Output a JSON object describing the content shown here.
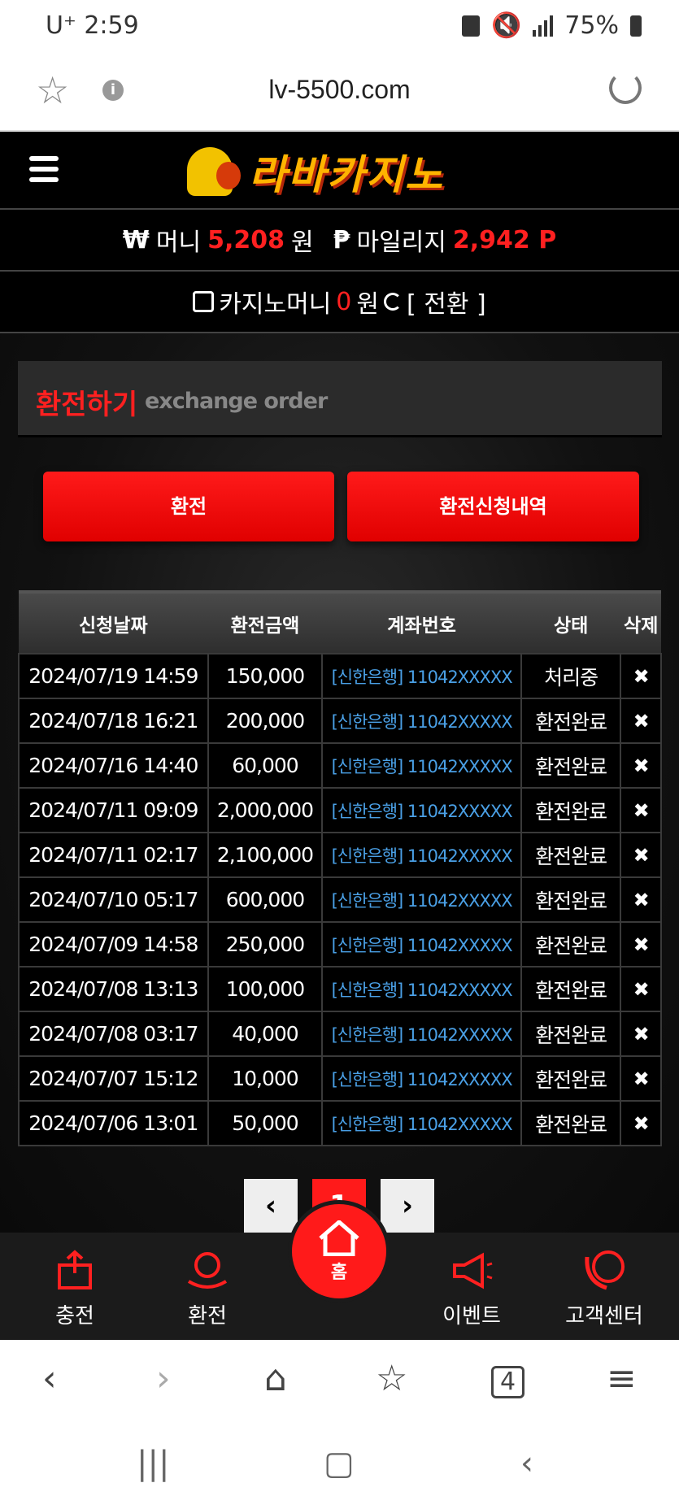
{
  "status_bar": {
    "carrier": "U⁺ 2:59",
    "battery": "75%"
  },
  "browser": {
    "url": "lv-5500.com"
  },
  "header": {
    "logo_text": "라바카지노"
  },
  "balance": {
    "money_symbol": "₩",
    "money_label": "머니",
    "money_value": "5,208",
    "money_unit": "원",
    "mileage_symbol": "₱",
    "mileage_label": "마일리지",
    "mileage_value": "2,942 P"
  },
  "casino": {
    "label": "카지노머니",
    "value": "0",
    "unit": "원",
    "convert_label": "[ 전환 ]"
  },
  "page": {
    "title_ko": "환전하기",
    "title_en": "exchange order"
  },
  "buttons": {
    "exchange": "환전",
    "history": "환전신청내역"
  },
  "table": {
    "headers": [
      "신청날짜",
      "환전금액",
      "계좌번호",
      "상태",
      "삭제"
    ],
    "rows": [
      {
        "date": "2024/07/19 14:59",
        "amount": "150,000",
        "account": "[신한은행] 11042XXXXX",
        "status": "처리중",
        "del": "✖"
      },
      {
        "date": "2024/07/18 16:21",
        "amount": "200,000",
        "account": "[신한은행] 11042XXXXX",
        "status": "환전완료",
        "del": "✖"
      },
      {
        "date": "2024/07/16 14:40",
        "amount": "60,000",
        "account": "[신한은행] 11042XXXXX",
        "status": "환전완료",
        "del": "✖"
      },
      {
        "date": "2024/07/11 09:09",
        "amount": "2,000,000",
        "account": "[신한은행] 11042XXXXX",
        "status": "환전완료",
        "del": "✖"
      },
      {
        "date": "2024/07/11 02:17",
        "amount": "2,100,000",
        "account": "[신한은행] 11042XXXXX",
        "status": "환전완료",
        "del": "✖"
      },
      {
        "date": "2024/07/10 05:17",
        "amount": "600,000",
        "account": "[신한은행] 11042XXXXX",
        "status": "환전완료",
        "del": "✖"
      },
      {
        "date": "2024/07/09 14:58",
        "amount": "250,000",
        "account": "[신한은행] 11042XXXXX",
        "status": "환전완료",
        "del": "✖"
      },
      {
        "date": "2024/07/08 13:13",
        "amount": "100,000",
        "account": "[신한은행] 11042XXXXX",
        "status": "환전완료",
        "del": "✖"
      },
      {
        "date": "2024/07/08 03:17",
        "amount": "40,000",
        "account": "[신한은행] 11042XXXXX",
        "status": "환전완료",
        "del": "✖"
      },
      {
        "date": "2024/07/07 15:12",
        "amount": "10,000",
        "account": "[신한은행] 11042XXXXX",
        "status": "환전완료",
        "del": "✖"
      },
      {
        "date": "2024/07/06 13:01",
        "amount": "50,000",
        "account": "[신한은행] 11042XXXXX",
        "status": "환전완료",
        "del": "✖"
      }
    ]
  },
  "pager": {
    "prev": "‹",
    "current": "1",
    "next": "›"
  },
  "bottom_nav": {
    "charge": "충전",
    "exchange": "환전",
    "home": "홈",
    "event": "이벤트",
    "support": "고객센터"
  },
  "colors": {
    "accent": "#ff1a1a",
    "account_link": "#4aa0e6",
    "background": "#0a0a0a"
  }
}
